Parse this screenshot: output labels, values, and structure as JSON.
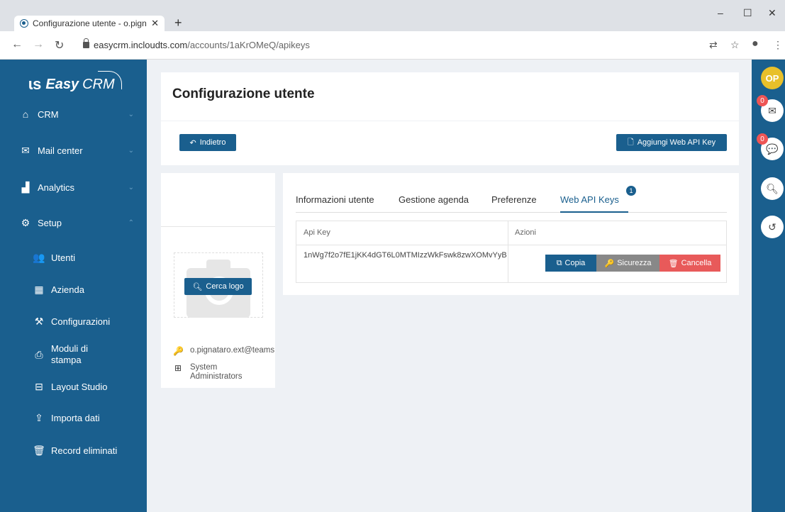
{
  "browser": {
    "tab_title": "Configurazione utente - o.pignat",
    "tab_close": "✕",
    "new_tab": "+",
    "url_host": "easycrm.incloudts.com",
    "url_path": "/accounts/1aKrOMeQ/apikeys"
  },
  "sidebar": {
    "logo_text": "Easy",
    "logo_crm": "CRM",
    "items": [
      {
        "label": "CRM",
        "icon": "home-icon"
      },
      {
        "label": "Mail center",
        "icon": "mail-icon"
      },
      {
        "label": "Analytics",
        "icon": "chart-icon"
      },
      {
        "label": "Setup",
        "icon": "gear-icon"
      }
    ],
    "subitems": [
      {
        "label": "Utenti",
        "icon": "users-icon"
      },
      {
        "label": "Azienda",
        "icon": "building-icon"
      },
      {
        "label": "Configurazioni",
        "icon": "tools-icon"
      },
      {
        "label": "Moduli di",
        "label2": "stampa",
        "icon": "printer-icon"
      },
      {
        "label": "Layout Studio",
        "icon": "layout-icon"
      },
      {
        "label": "Importa dati",
        "icon": "import-icon"
      },
      {
        "label": "Record eliminati",
        "icon": "trash-icon"
      }
    ]
  },
  "rightbar": {
    "avatar_initials": "OP",
    "mail_badge": "0",
    "chat_badge": "0"
  },
  "header": {
    "title": "Configurazione utente",
    "back_label": "Indietro",
    "add_key_label": "Aggiungi Web API Key"
  },
  "profile": {
    "search_logo_label": "Cerca logo",
    "username": "o.pignataro.ext@teams",
    "role_line1": "System",
    "role_line2": "Administrators"
  },
  "tabs": [
    {
      "label": "Informazioni utente"
    },
    {
      "label": "Gestione agenda"
    },
    {
      "label": "Preferenze"
    },
    {
      "label": "Web API Keys",
      "badge": "1"
    }
  ],
  "table": {
    "headers": [
      "Api Key",
      "Azioni"
    ],
    "rows": [
      {
        "key": "1nWg7f2o7fE1jKK4dGT6L0MTMIzzWkFswk8zwXOMvYyB"
      }
    ],
    "actions": {
      "copy": "Copia",
      "security": "Sicurezza",
      "delete": "Cancella"
    }
  },
  "colors": {
    "primary": "#1a5f8e",
    "security": "#888888",
    "delete": "#e85a5a"
  }
}
